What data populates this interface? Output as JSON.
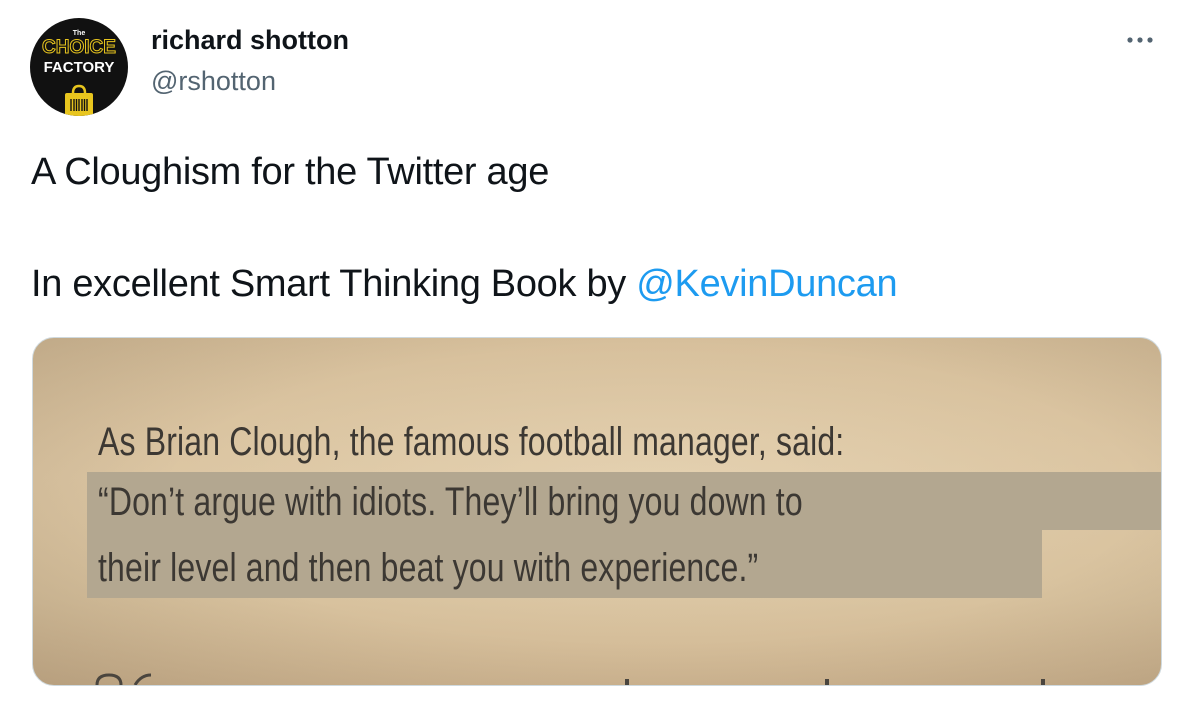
{
  "author": {
    "name": "richard shotton",
    "handle": "@rshotton",
    "avatar": {
      "top_text": "The",
      "brand_line1": "CHOICE",
      "brand_line2": "FACTORY",
      "accent_color": "#e8c51e"
    }
  },
  "tweet": {
    "line1": "A Cloughism for the Twitter age",
    "line2_prefix": "In excellent Smart Thinking Book by ",
    "mention": "@KevinDuncan"
  },
  "media": {
    "book_lines": [
      "As Brian Clough, the famous football manager, said:",
      "“Don’t argue with idiots. They’ll bring you down to",
      "their level and then beat you with experience.”"
    ]
  },
  "colors": {
    "link": "#1d9bf0",
    "text": "#0f1419",
    "secondary": "#536471"
  },
  "icons": {
    "more": "more-horizontal-icon"
  }
}
